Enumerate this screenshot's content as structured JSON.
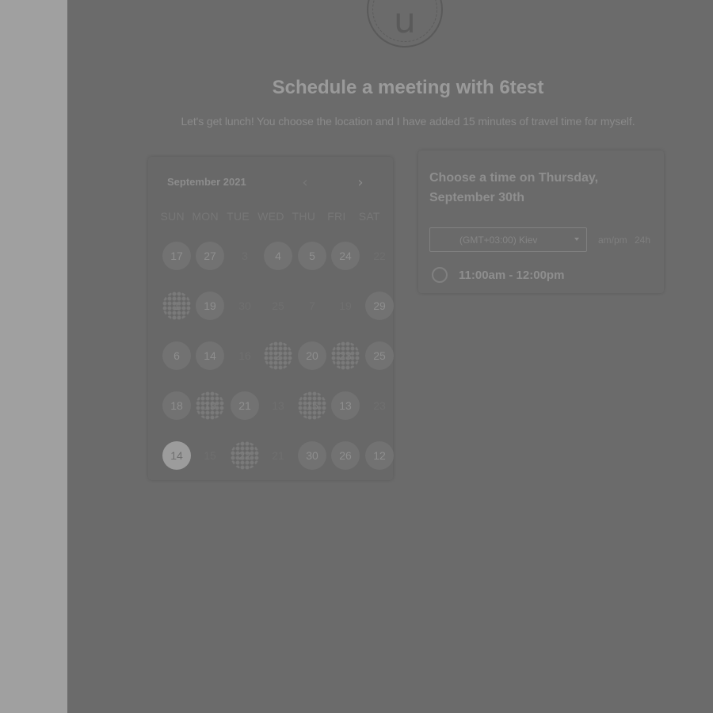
{
  "avatar": {
    "letter": "u"
  },
  "header": {
    "title": "Schedule a meeting with 6test",
    "subtitle": "Let's get lunch! You choose the location and I have added 15 minutes of travel time for myself."
  },
  "calendar": {
    "month_label": "September 2021",
    "prev_icon": "chevron-left-icon",
    "next_icon": "chevron-right-icon",
    "weekdays": [
      "SUN",
      "MON",
      "TUE",
      "WED",
      "THU",
      "FRI",
      "SAT"
    ],
    "weeks": [
      [
        {
          "label": "17",
          "state": "avail"
        },
        {
          "label": "27",
          "state": "avail"
        },
        {
          "label": "3",
          "state": "faded"
        },
        {
          "label": "4",
          "state": "avail"
        },
        {
          "label": "5",
          "state": "avail"
        },
        {
          "label": "24",
          "state": "avail"
        },
        {
          "label": "22",
          "state": "faded"
        }
      ],
      [
        {
          "label": "1",
          "state": "busy"
        },
        {
          "label": "19",
          "state": "avail"
        },
        {
          "label": "30",
          "state": "faded"
        },
        {
          "label": "25",
          "state": "faded"
        },
        {
          "label": "7",
          "state": "faded"
        },
        {
          "label": "19",
          "state": "faded"
        },
        {
          "label": "29",
          "state": "avail"
        }
      ],
      [
        {
          "label": "6",
          "state": "avail"
        },
        {
          "label": "14",
          "state": "avail"
        },
        {
          "label": "16",
          "state": "faded"
        },
        {
          "label": "2",
          "state": "busy"
        },
        {
          "label": "20",
          "state": "avail"
        },
        {
          "label": "23",
          "state": "busy"
        },
        {
          "label": "25",
          "state": "avail"
        }
      ],
      [
        {
          "label": "18",
          "state": "avail"
        },
        {
          "label": "19",
          "state": "busy"
        },
        {
          "label": "21",
          "state": "avail"
        },
        {
          "label": "13",
          "state": "faded"
        },
        {
          "label": "15",
          "state": "busy"
        },
        {
          "label": "13",
          "state": "avail"
        },
        {
          "label": "23",
          "state": "faded"
        }
      ],
      [
        {
          "label": "14",
          "state": "selected"
        },
        {
          "label": "15",
          "state": "faded"
        },
        {
          "label": "22",
          "state": "busy"
        },
        {
          "label": "21",
          "state": "faded"
        },
        {
          "label": "30",
          "state": "avail"
        },
        {
          "label": "26",
          "state": "avail"
        },
        {
          "label": "12",
          "state": "avail"
        }
      ]
    ]
  },
  "times": {
    "heading": "Choose a time on Thursday, September 30th",
    "timezone": "(GMT+03:00) Kiev",
    "format_ampm": "am/pm",
    "format_24h": "24h",
    "slots": [
      {
        "label": "11:00am - 12:00pm"
      }
    ]
  }
}
